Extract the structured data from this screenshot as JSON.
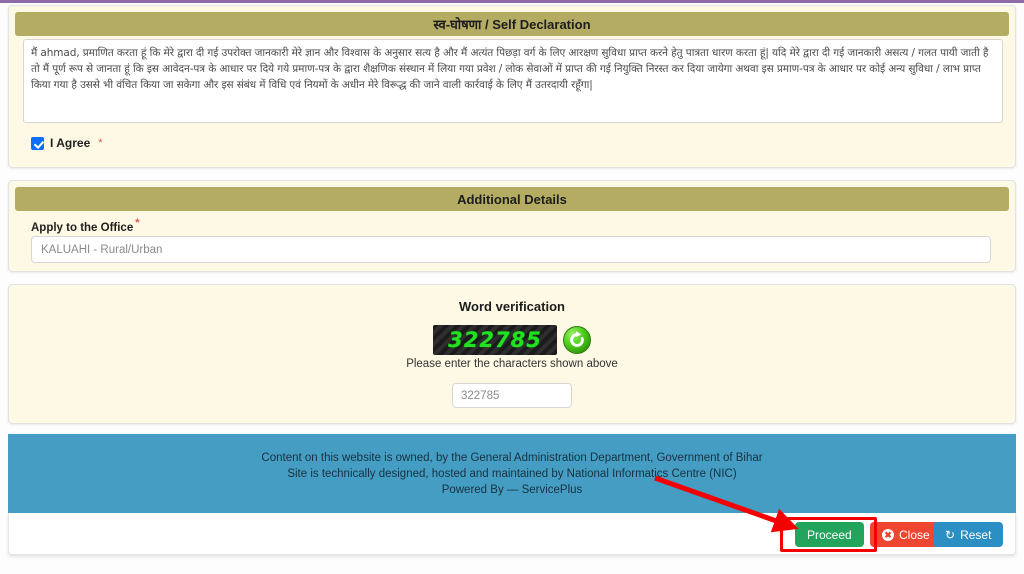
{
  "declaration": {
    "header": "स्व-घोषणा / Self Declaration",
    "body": "मैं  ahmad, प्रमाणित करता हूं कि मेरे द्वारा दी गई उपरोक्त जानकारी मेरे ज्ञान और विश्वास के अनुसार सत्य है और मैं अत्यंत पिछड़ा वर्ग के लिए आरक्षण सुविधा प्राप्त करने हेतु पात्रता धारण करता हूं| यदि मेरे द्वारा दी गई जानकारी असत्य / गलत पायी जाती है तो मैं पूर्ण रूप से  जानता हूं कि इस आवेदन-पत्र के आधार पर दिये गये प्रमाण-पत्र के द्वारा शैक्षणिक संस्थान में लिया गया प्रवेश / लोक सेवाओं में प्राप्त की गई नियुक्ति निरस्त  कर दिया जायेगा अथवा इस प्रमाण-पत्र के आधार पर कोई अन्य सुविधा / लाभ प्राप्त किया गया है उससे भी वंचित किया जा सकेगा और इस संबंध में विधि एवं नियमों के अधीन मेरे विरूद्ध की जाने वाली कार्रवाई के लिए मैं उतरदायी रहूँगा|",
    "agree_label": "I Agree",
    "required_marker": "*",
    "agree_checked": true
  },
  "additional": {
    "header": "Additional Details",
    "office_label": "Apply to the Office",
    "required_marker": "*",
    "office_value": "KALUAHI - Rural/Urban"
  },
  "captcha": {
    "title": "Word verification",
    "code": "322785",
    "hint": "Please enter the characters shown above",
    "entered_value": "322785",
    "refresh_icon": "refresh-icon",
    "code_color": "#22e022"
  },
  "footer": {
    "line1": "Content on this website is owned, by the General Administration Department, Government of Bihar",
    "line2": "Site is technically designed, hosted and maintained by National Informatics Centre (NIC)",
    "line3": "Powered By — ServicePlus",
    "background_color": "#459dc4"
  },
  "actions": {
    "proceed_label": "Proceed",
    "close_label": "Close",
    "close_icon": "close-circle-icon",
    "reset_label": "Reset",
    "reset_icon": "refresh-icon",
    "proceed_color": "#22a45d",
    "close_color": "#ef4631",
    "reset_color": "#2b8fc4"
  },
  "annotations": {
    "highlight_color": "#f40000",
    "arrow_color": "#f40000"
  },
  "theme": {
    "section_header_color": "#b5ac63",
    "card_background": "#fdf9e4",
    "top_strip_color": "#8e6ca8"
  }
}
